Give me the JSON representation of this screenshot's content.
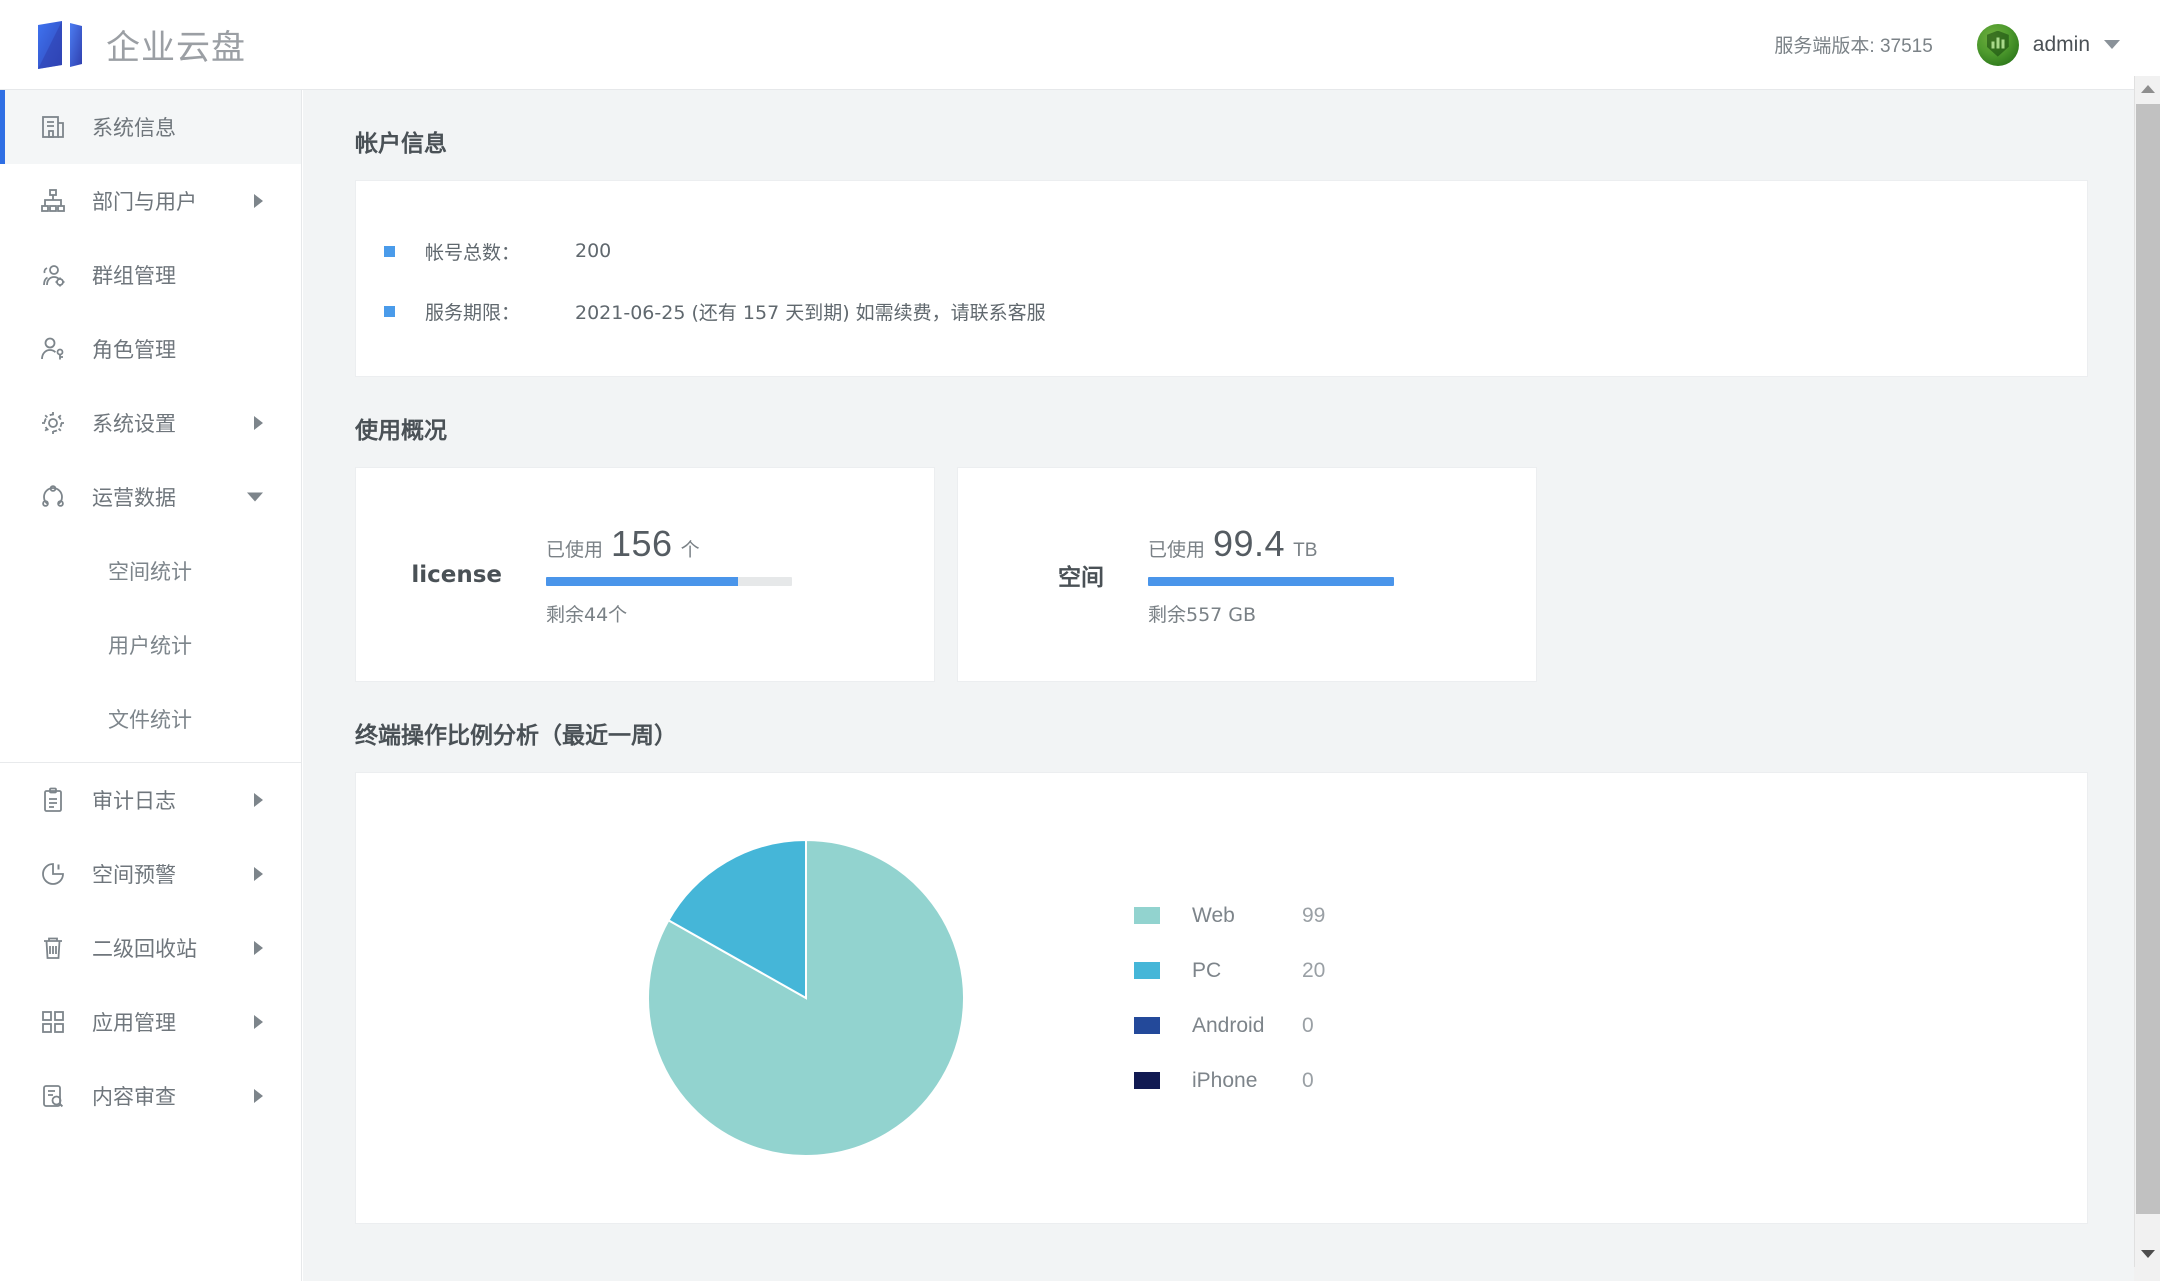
{
  "header": {
    "brand_name": "企业云盘",
    "logo_icon": "cloud-disk-logo-icon",
    "server_version": "服务端版本: 37515",
    "user_name": "admin",
    "caret_icon": "chevron-down-icon",
    "avatar_icon": "user-avatar"
  },
  "sidebar": {
    "items": [
      {
        "label": "系统信息",
        "icon": "server-info-icon",
        "active": true,
        "arrow": "none"
      },
      {
        "label": "部门与用户",
        "icon": "org-tree-icon",
        "active": false,
        "arrow": "right"
      },
      {
        "label": "群组管理",
        "icon": "group-settings-icon",
        "active": false,
        "arrow": "none"
      },
      {
        "label": "角色管理",
        "icon": "user-role-icon",
        "active": false,
        "arrow": "none"
      },
      {
        "label": "系统设置",
        "icon": "gear-icon",
        "active": false,
        "arrow": "right"
      },
      {
        "label": "运营数据",
        "icon": "analytics-icon",
        "active": false,
        "arrow": "down"
      }
    ],
    "sub_items": [
      {
        "label": "空间统计"
      },
      {
        "label": "用户统计"
      },
      {
        "label": "文件统计"
      }
    ],
    "items_bottom": [
      {
        "label": "审计日志",
        "icon": "clipboard-icon",
        "arrow": "right"
      },
      {
        "label": "空间预警",
        "icon": "pie-alert-icon",
        "arrow": "right"
      },
      {
        "label": "二级回收站",
        "icon": "trash-icon",
        "arrow": "right"
      },
      {
        "label": "应用管理",
        "icon": "grid-apps-icon",
        "arrow": "right"
      },
      {
        "label": "内容审查",
        "icon": "content-review-icon",
        "arrow": "right"
      }
    ]
  },
  "account_section": {
    "title": "帐户信息",
    "rows": [
      {
        "label": "帐号总数：",
        "value": "200"
      },
      {
        "label": "服务期限：",
        "value": "2021-06-25 (还有 157 天到期) 如需续费，请联系客服"
      }
    ]
  },
  "usage_section": {
    "title": "使用概况",
    "cards": [
      {
        "name": "license",
        "used_prefix": "已使用",
        "used_number": "156",
        "used_unit": "个",
        "percent": 78,
        "remaining": "剩余44个"
      },
      {
        "name": "空间",
        "used_prefix": "已使用",
        "used_number": "99.4",
        "used_unit": "TB",
        "percent": 100,
        "remaining": "剩余557 GB"
      }
    ]
  },
  "chart_section": {
    "title": "终端操作比例分析（最近一周）"
  },
  "chart_data": {
    "type": "pie",
    "title": "终端操作比例分析（最近一周）",
    "categories": [
      "Web",
      "PC",
      "Android",
      "iPhone"
    ],
    "values": [
      99,
      20,
      0,
      0
    ],
    "colors": [
      "#92d3cf",
      "#45b6d8",
      "#23499a",
      "#111a52"
    ],
    "legend_position": "right",
    "total": 119,
    "start_angle": 0,
    "direction": "clockwise"
  },
  "scrollbar": {
    "up_icon": "scroll-up-arrow-icon",
    "down_icon": "scroll-down-arrow-icon"
  },
  "colors": {
    "accent_blue": "#2f6fe4",
    "progress_blue": "#4a95ea",
    "bullet_blue": "#4a9bea",
    "content_bg": "#f2f4f5"
  }
}
